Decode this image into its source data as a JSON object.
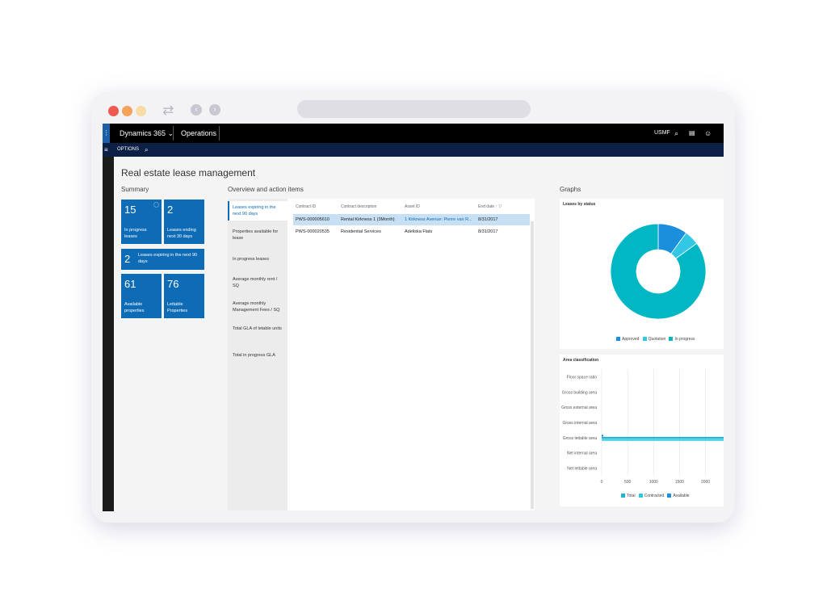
{
  "topbar": {
    "app": "Dynamics 365",
    "module": "Operations",
    "company": "USMF"
  },
  "actionbar": {
    "options": "OPTIONS"
  },
  "page": {
    "title": "Real estate lease management"
  },
  "summary": {
    "heading": "Summary",
    "tiles": [
      {
        "value": "15",
        "label": "In progress leases"
      },
      {
        "value": "2",
        "label": "Leases ending next 30 days"
      },
      {
        "value": "2",
        "label": "Leases expiring in the next 90 days"
      },
      {
        "value": "61",
        "label": "Available properties"
      },
      {
        "value": "76",
        "label": "Lettable Properties"
      }
    ]
  },
  "overview": {
    "heading": "Overview and action items",
    "menu": [
      "Leases expiring in the next 90 days",
      "Properties available for lease",
      "In progress leases",
      "Average monthly rent / SQ",
      "Average monthly Management Fees / SQ",
      "Total GLA of letable units",
      "Total in progress GLA"
    ],
    "columns": [
      "Contract ID",
      "Contract description",
      "Asset ID",
      "End date"
    ],
    "rows": [
      [
        "PWS-000005610",
        "Rental Kirkness 1 (3Month)",
        "1 Kirkness Avenue: Pierre van R...",
        "8/31/2017"
      ],
      [
        "PWS-000020535",
        "Residential Services",
        "Adeliska Flats",
        "8/31/2017"
      ]
    ]
  },
  "graphs": {
    "heading": "Graphs",
    "status": {
      "title": "Leases by status",
      "legend": [
        "Approved",
        "Quotation",
        "In progress"
      ]
    },
    "area": {
      "title": "Area classification",
      "legend": [
        "Total",
        "Contracted",
        "Available"
      ]
    }
  },
  "chart_data": [
    {
      "type": "pie",
      "title": "Leases by status",
      "labels": [
        "Approved",
        "Quotation",
        "In progress"
      ],
      "values": [
        10,
        5,
        85
      ],
      "colors": [
        "#1b8fdb",
        "#33c7e6",
        "#00b7c3"
      ]
    },
    {
      "type": "bar",
      "orientation": "horizontal",
      "title": "Area classification",
      "categories": [
        "Floor space ratio",
        "Gross building area",
        "Gross external area",
        "Gross internal area",
        "Gross lettable area",
        "Net internal area",
        "Net lettable area"
      ],
      "series": [
        {
          "name": "Total",
          "values": [
            0,
            0,
            0,
            0,
            2400,
            0,
            0
          ],
          "color": "#1fb4d4"
        },
        {
          "name": "Contracted",
          "values": [
            0,
            0,
            0,
            0,
            2400,
            0,
            0
          ],
          "color": "#33c7e6"
        },
        {
          "name": "Available",
          "values": [
            0,
            0,
            0,
            0,
            20,
            0,
            0
          ],
          "color": "#1b8fdb"
        }
      ],
      "xticks": [
        "0",
        "500",
        "1000",
        "1500",
        "2000"
      ],
      "xlim": [
        0,
        2350
      ]
    }
  ]
}
